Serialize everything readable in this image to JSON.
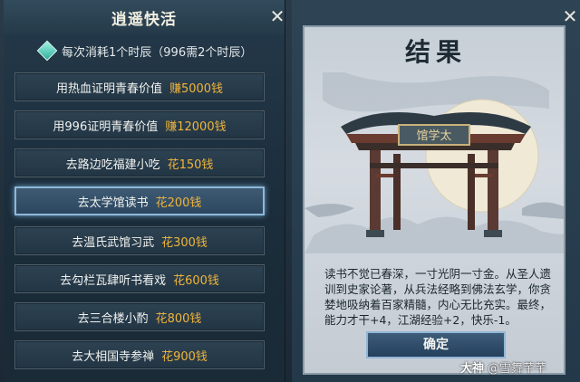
{
  "left": {
    "title": "逍遥快活",
    "close": "✕",
    "info": "每次消耗1个时辰（996需2个时辰）",
    "options": [
      {
        "label": "用热血证明青春价值",
        "cost": "赚5000钱",
        "selected": false
      },
      {
        "label": "用996证明青春价值",
        "cost": "赚12000钱",
        "selected": false
      },
      {
        "label": "去路边吃福建小吃",
        "cost": "花150钱",
        "selected": false
      },
      {
        "label": "去太学馆读书",
        "cost": "花200钱",
        "selected": true
      },
      {
        "label": "去温氏武馆习武",
        "cost": "花300钱",
        "selected": false
      },
      {
        "label": "去勾栏瓦肆听书看戏",
        "cost": "花600钱",
        "selected": false
      },
      {
        "label": "去三合楼小酌",
        "cost": "花800钱",
        "selected": false
      },
      {
        "label": "去大相国寺参禅",
        "cost": "花900钱",
        "selected": false
      }
    ]
  },
  "right": {
    "close": "✕",
    "title": "结果",
    "sign_text": "馆学太",
    "result_text": "读书不觉已春深，一寸光阴一寸金。从圣人遗训到史家论著，从兵法经略到佛法玄学，你贪婪地吸纳着百家精髓，内心无比充实。最终，能力才干+4，江湖经验+2，快乐-1。",
    "confirm": "确定"
  },
  "watermark": {
    "brand": "大神",
    "user": "@雪舞芊芊"
  },
  "colors": {
    "cost": "#f1b53a",
    "selected_border": "#8fb7d8"
  }
}
